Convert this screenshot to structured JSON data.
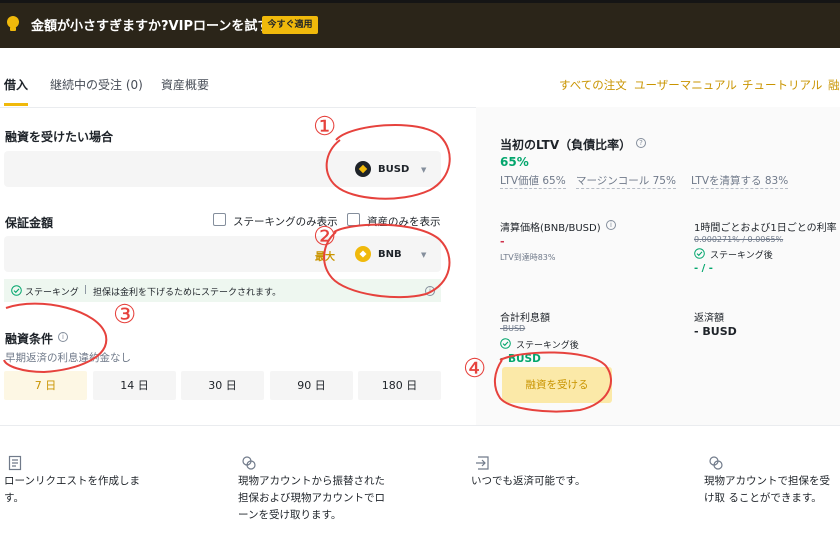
{
  "banner": {
    "text": "金額が小さすぎますか?VIPローンを試す",
    "button": "今すぐ適用"
  },
  "tabs": [
    {
      "label": "借入"
    },
    {
      "label": "継続中の受注 (0)"
    },
    {
      "label": "資産概要"
    }
  ],
  "right_links": [
    "すべての注文",
    "ユーザーマニュアル",
    "チュートリアル",
    "融"
  ],
  "loan": {
    "label": "融資を受けたい場合",
    "coin": "BUSD"
  },
  "collateral": {
    "label": "保証金額",
    "staking_only": "ステーキングのみ表示",
    "assets_only": "資産のみを表示",
    "max": "最大",
    "coin": "BNB"
  },
  "staking_banner": {
    "tag": "ステーキング",
    "sep": "|",
    "text": "担保は金利を下げるためにステークされます。"
  },
  "terms": {
    "label": "融資条件",
    "sub": "早期返済の利息違約金なし",
    "durations": [
      "7 日",
      "14 日",
      "30 日",
      "90 日",
      "180 日"
    ],
    "selected_index": 0
  },
  "ltv": {
    "title": "当初のLTV（負債比率）",
    "value": "65%",
    "links": [
      "LTV価値 65%",
      "マージンコール 75%",
      "LTVを清算する 83%"
    ]
  },
  "liquidation": {
    "label": "清算価格(BNB/BUSD)",
    "value": "-",
    "sub": "LTV到達時83%"
  },
  "hourly": {
    "label": "1時間ごとおよび1日ごとの利率",
    "strike": "0.000271% / 0.0065%",
    "staking": "ステーキング後",
    "value": "- / -"
  },
  "interest": {
    "label": "合計利息額",
    "strike": "-BUSD",
    "staking": "ステーキング後",
    "value": "- BUSD"
  },
  "repay": {
    "label": "返済額",
    "value": "- BUSD"
  },
  "apply_button": "融資を受ける",
  "steps": [
    {
      "icon": "document-icon",
      "text": "ローンリクエストを作成しま す。"
    },
    {
      "icon": "transfer-icon",
      "text": "現物アカウントから振替された 担保および現物アカウントでロ ーンを受け取ります。"
    },
    {
      "icon": "repay-icon",
      "text": "いつでも返済可能です。"
    },
    {
      "icon": "transfer-icon",
      "text": "現物アカウントで担保を受け取 ることができます。"
    }
  ],
  "annotations": [
    "①",
    "②",
    "③",
    "④"
  ],
  "colors": {
    "accent": "#f0b90b",
    "annotation": "#e6423d",
    "green": "#03a66d",
    "red": "#cf304a"
  }
}
